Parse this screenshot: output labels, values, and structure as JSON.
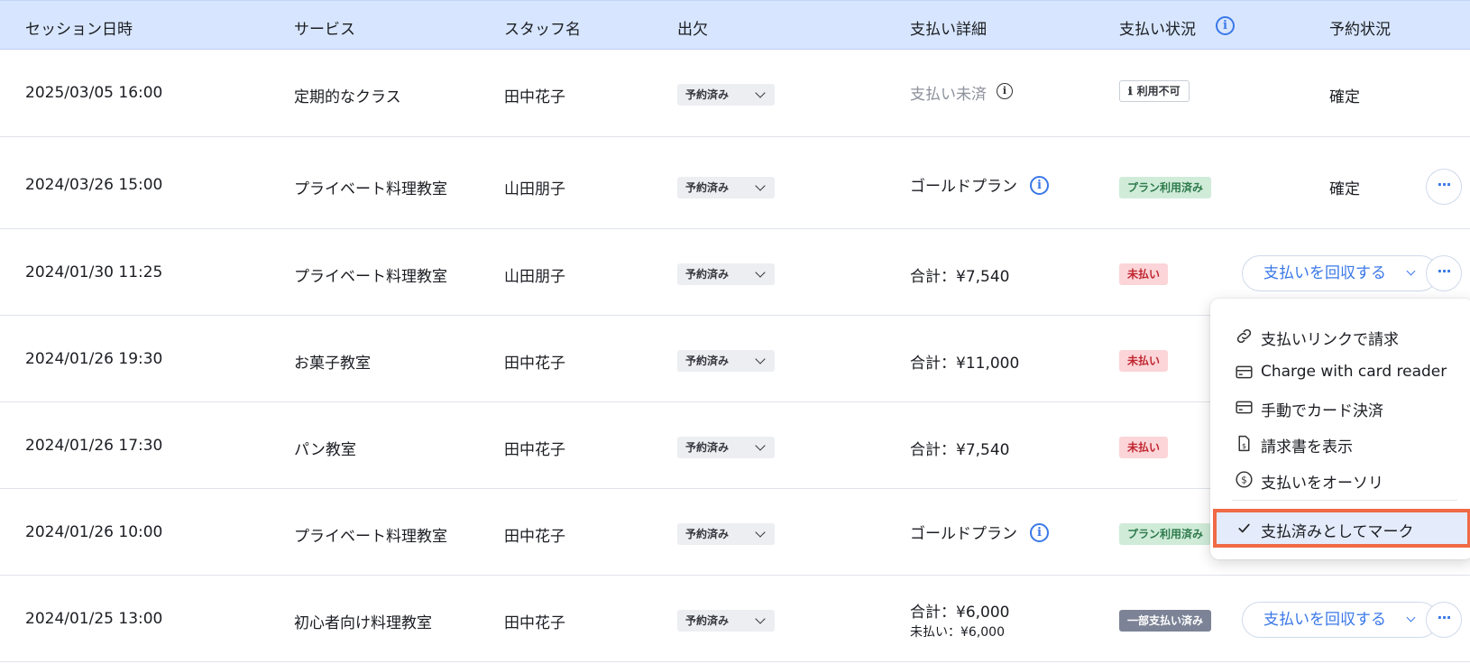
{
  "colors": {
    "header_bg": "#d7e6fe",
    "accent": "#3a78e8",
    "unpaid": "#c0252f",
    "plan_used": "#2e7a4c",
    "highlight_border": "#ef6a45"
  },
  "header": {
    "session": "セッション日時",
    "service": "サービス",
    "staff": "スタッフ名",
    "attendance": "出欠",
    "payment_details": "支払い詳細",
    "payment_status": "支払い状況",
    "payment_status_info_icon": "info-icon",
    "booking_status": "予約状況"
  },
  "rows": [
    {
      "session": "2025/03/05 16:00",
      "service": "定期的なクラス",
      "staff": "田中花子",
      "attendance": "予約済み",
      "payment_detail": "支払い未済",
      "payment_status": "利用不可",
      "booking_status": "確定"
    },
    {
      "session": "2024/03/26 15:00",
      "service": "プライベート料理教室",
      "staff": "山田朋子",
      "attendance": "予約済み",
      "payment_detail": "ゴールドプラン",
      "payment_status": "プラン利用済み",
      "booking_status": "確定",
      "more": "···"
    },
    {
      "session": "2024/01/30 11:25",
      "service": "プライベート料理教室",
      "staff": "山田朋子",
      "attendance": "予約済み",
      "payment_detail": "合計：¥7,540",
      "payment_status": "未払い",
      "action": "支払いを回収する",
      "more": "···"
    },
    {
      "session": "2024/01/26 19:30",
      "service": "お菓子教室",
      "staff": "田中花子",
      "attendance": "予約済み",
      "payment_detail": "合計：¥11,000",
      "payment_status": "未払い"
    },
    {
      "session": "2024/01/26 17:30",
      "service": "パン教室",
      "staff": "田中花子",
      "attendance": "予約済み",
      "payment_detail": "合計：¥7,540",
      "payment_status": "未払い"
    },
    {
      "session": "2024/01/26 10:00",
      "service": "プライベート料理教室",
      "staff": "田中花子",
      "attendance": "予約済み",
      "payment_detail": "ゴールドプラン",
      "payment_status": "プラン利用済み"
    },
    {
      "session": "2024/01/25 13:00",
      "service": "初心者向け料理教室",
      "staff": "田中花子",
      "attendance": "予約済み",
      "payment_detail": "合計：¥6,000",
      "payment_detail_sub": "未払い：¥6,000",
      "payment_status": "一部支払い済み",
      "action": "支払いを回収する",
      "more": "···"
    }
  ],
  "dropdown_menu": {
    "items": [
      {
        "label": "支払いリンクで請求",
        "icon": "link-icon"
      },
      {
        "label": "Charge with card reader",
        "icon": "card-icon"
      },
      {
        "label": "手動でカード決済",
        "icon": "card-icon"
      },
      {
        "label": "請求書を表示",
        "icon": "invoice-icon"
      },
      {
        "label": "支払いをオーソリ",
        "icon": "dollar-circle-icon"
      }
    ],
    "highlighted_item": {
      "label": "支払済みとしてマーク",
      "icon": "check-icon"
    }
  }
}
